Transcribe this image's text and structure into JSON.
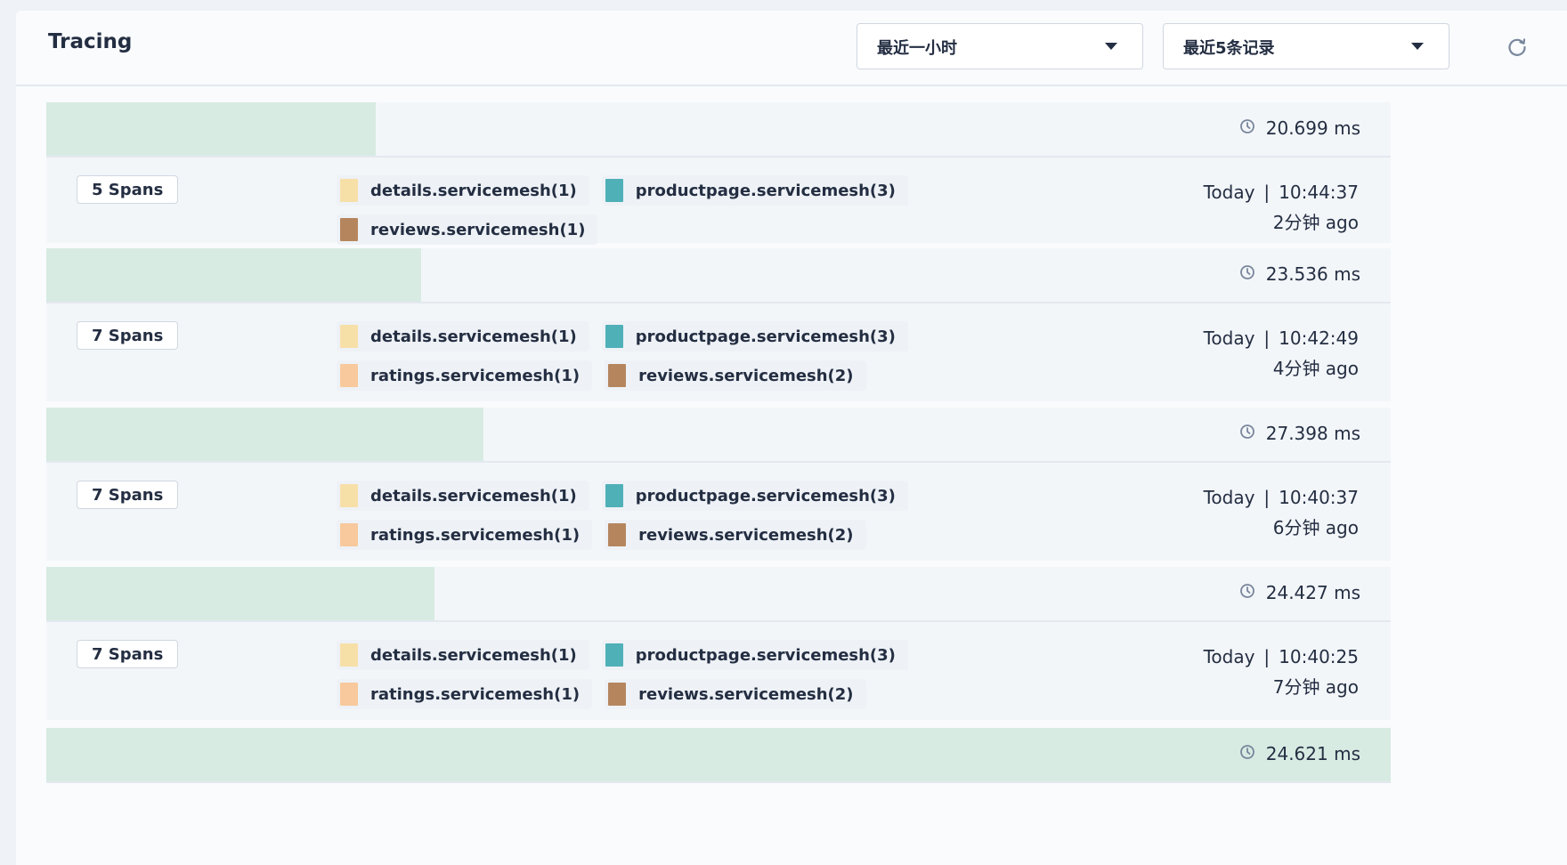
{
  "header": {
    "title": "Tracing",
    "time_range": "最近一小时",
    "limit": "最近5条记录"
  },
  "colors": {
    "details": "#f7dfa8",
    "productpage": "#4fb0b8",
    "ratings": "#f7c99c",
    "reviews": "#b5865e",
    "duration_bar": "#d8ebe3"
  },
  "traces": [
    {
      "duration": "20.699 ms",
      "duration_fraction": 0.245,
      "spans": "5 Spans",
      "services": [
        {
          "name": "details.servicemesh(1)",
          "color": "#f7dfa8"
        },
        {
          "name": "productpage.servicemesh(3)",
          "color": "#4fb0b8"
        },
        {
          "name": "reviews.servicemesh(1)",
          "color": "#b5865e"
        }
      ],
      "day": "Today",
      "time": "10:44:37",
      "ago": "2分钟 ago"
    },
    {
      "duration": "23.536 ms",
      "duration_fraction": 0.279,
      "spans": "7 Spans",
      "services": [
        {
          "name": "details.servicemesh(1)",
          "color": "#f7dfa8"
        },
        {
          "name": "productpage.servicemesh(3)",
          "color": "#4fb0b8"
        },
        {
          "name": "ratings.servicemesh(1)",
          "color": "#f7c99c"
        },
        {
          "name": "reviews.servicemesh(2)",
          "color": "#b5865e"
        }
      ],
      "day": "Today",
      "time": "10:42:49",
      "ago": "4分钟 ago"
    },
    {
      "duration": "27.398 ms",
      "duration_fraction": 0.325,
      "spans": "7 Spans",
      "services": [
        {
          "name": "details.servicemesh(1)",
          "color": "#f7dfa8"
        },
        {
          "name": "productpage.servicemesh(3)",
          "color": "#4fb0b8"
        },
        {
          "name": "ratings.servicemesh(1)",
          "color": "#f7c99c"
        },
        {
          "name": "reviews.servicemesh(2)",
          "color": "#b5865e"
        }
      ],
      "day": "Today",
      "time": "10:40:37",
      "ago": "6分钟 ago"
    },
    {
      "duration": "24.427 ms",
      "duration_fraction": 0.289,
      "spans": "7 Spans",
      "services": [
        {
          "name": "details.servicemesh(1)",
          "color": "#f7dfa8"
        },
        {
          "name": "productpage.servicemesh(3)",
          "color": "#4fb0b8"
        },
        {
          "name": "ratings.servicemesh(1)",
          "color": "#f7c99c"
        },
        {
          "name": "reviews.servicemesh(2)",
          "color": "#b5865e"
        }
      ],
      "day": "Today",
      "time": "10:40:25",
      "ago": "7分钟 ago"
    },
    {
      "duration": "24.621 ms",
      "duration_fraction": 1.0,
      "spans": "",
      "services": [],
      "day": "",
      "time": "",
      "ago": ""
    }
  ]
}
